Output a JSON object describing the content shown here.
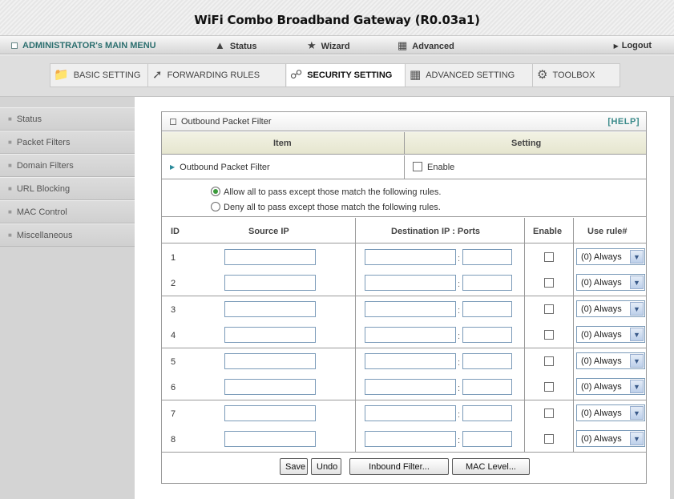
{
  "window": {
    "title": "WiFi Combo Broadband Gateway (R0.03a1)"
  },
  "topmenu": {
    "admin_label": "ADMINISTRATOR's MAIN MENU",
    "status": "Status",
    "wizard": "Wizard",
    "advanced": "Advanced",
    "logout": "Logout"
  },
  "tabs": [
    {
      "label": "BASIC SETTING",
      "icon": "folder-icon"
    },
    {
      "label": "FORWARDING RULES",
      "icon": "forwarding-icon"
    },
    {
      "label": "SECURITY SETTING",
      "icon": "security-icon",
      "active": true
    },
    {
      "label": "ADVANCED SETTING",
      "icon": "advanced-icon"
    },
    {
      "label": "TOOLBOX",
      "icon": "toolbox-icon"
    }
  ],
  "sidebar": {
    "items": [
      {
        "label": "Status"
      },
      {
        "label": "Packet Filters"
      },
      {
        "label": "Domain Filters"
      },
      {
        "label": "URL Blocking"
      },
      {
        "label": "MAC Control"
      },
      {
        "label": "Miscellaneous"
      }
    ]
  },
  "panel": {
    "title": "Outbound Packet Filter",
    "help": "[HELP]",
    "header_item": "Item",
    "header_setting": "Setting",
    "opf_label": "Outbound Packet Filter",
    "enable_label": "Enable",
    "radio_allow": "Allow all to pass except those match the following rules.",
    "radio_deny": "Deny all to pass except those match the following rules.",
    "radio_selected": "allow"
  },
  "rules": {
    "headers": {
      "id": "ID",
      "source": "Source IP",
      "dest": "Destination IP : Ports",
      "enable": "Enable",
      "use_rule": "Use rule#"
    },
    "colon": ":",
    "rows": [
      {
        "id": "1",
        "source_ip": "",
        "dest_ip": "",
        "ports": "",
        "enabled": false,
        "rule": "(0) Always"
      },
      {
        "id": "2",
        "source_ip": "",
        "dest_ip": "",
        "ports": "",
        "enabled": false,
        "rule": "(0) Always"
      },
      {
        "id": "3",
        "source_ip": "",
        "dest_ip": "",
        "ports": "",
        "enabled": false,
        "rule": "(0) Always"
      },
      {
        "id": "4",
        "source_ip": "",
        "dest_ip": "",
        "ports": "",
        "enabled": false,
        "rule": "(0) Always"
      },
      {
        "id": "5",
        "source_ip": "",
        "dest_ip": "",
        "ports": "",
        "enabled": false,
        "rule": "(0) Always"
      },
      {
        "id": "6",
        "source_ip": "",
        "dest_ip": "",
        "ports": "",
        "enabled": false,
        "rule": "(0) Always"
      },
      {
        "id": "7",
        "source_ip": "",
        "dest_ip": "",
        "ports": "",
        "enabled": false,
        "rule": "(0) Always"
      },
      {
        "id": "8",
        "source_ip": "",
        "dest_ip": "",
        "ports": "",
        "enabled": false,
        "rule": "(0) Always"
      }
    ]
  },
  "buttons": {
    "save": "Save",
    "undo": "Undo",
    "inbound": "Inbound Filter...",
    "mac": "MAC Level..."
  },
  "colors": {
    "admin_text": "#2c6f6f",
    "help_text": "#3a8a8a",
    "header_band": "#e6e6cf",
    "sidebar_bg": "#d4d4d4",
    "radio_dot": "#3a9a3a"
  }
}
